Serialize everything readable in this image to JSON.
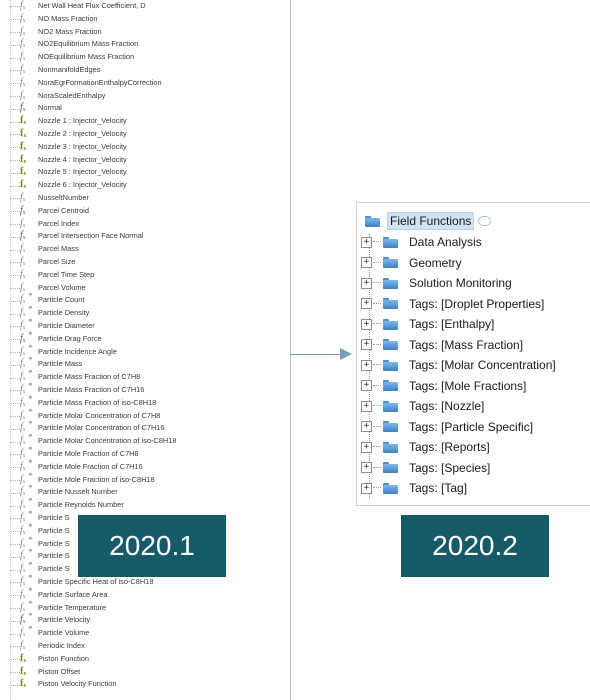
{
  "left_panel": {
    "version": "2020.1",
    "items": [
      {
        "label": "Net Wall Heat Flux Coefficient, D",
        "icon": "f-icon"
      },
      {
        "label": "NO Mass Fraction",
        "icon": "f-icon"
      },
      {
        "label": "NO2 Mass Fraction",
        "icon": "f-icon"
      },
      {
        "label": "NO2Equilibrium Mass Fraction",
        "icon": "f-icon"
      },
      {
        "label": "NOEquilibrium Mass Fraction",
        "icon": "f-icon"
      },
      {
        "label": "NonmanifoldEdges",
        "icon": "f-icon"
      },
      {
        "label": "NoraEgrFormationEnthalpyCorrection",
        "icon": "f-icon"
      },
      {
        "label": "NoraScaledEnthalpy",
        "icon": "f-icon"
      },
      {
        "label": "Normal",
        "icon": "vector-f-icon"
      },
      {
        "label": "Nozzle 1 : Injector_Velocity",
        "icon": "green-f-icon"
      },
      {
        "label": "Nozzle 2 : Injector_Velocity",
        "icon": "green-f-icon"
      },
      {
        "label": "Nozzle 3 : Injector_Velocity",
        "icon": "green-f-icon"
      },
      {
        "label": "Nozzle 4 : Injector_Velocity",
        "icon": "green-f-icon"
      },
      {
        "label": "Nozzle 5 : Injector_Velocity",
        "icon": "green-f-icon"
      },
      {
        "label": "Nozzle 6 : Injector_Velocity",
        "icon": "green-f-icon"
      },
      {
        "label": "NusseltNumber",
        "icon": "f-icon"
      },
      {
        "label": "Parcel Centroid",
        "icon": "vector-f-icon"
      },
      {
        "label": "Parcel Index",
        "icon": "f-icon"
      },
      {
        "label": "Parcel Intersection Face Normal",
        "icon": "vector-f-icon"
      },
      {
        "label": "Parcel Mass",
        "icon": "f-icon"
      },
      {
        "label": "Parcel Size",
        "icon": "f-icon"
      },
      {
        "label": "Parcel Time Step",
        "icon": "f-icon"
      },
      {
        "label": "Parcel Volume",
        "icon": "f-icon"
      },
      {
        "label": "Particle Count",
        "icon": "star-f-icon"
      },
      {
        "label": "Particle Density",
        "icon": "star-f-icon"
      },
      {
        "label": "Particle Diameter",
        "icon": "star-f-icon"
      },
      {
        "label": "Particle Drag Force",
        "icon": "star-vector-f-icon"
      },
      {
        "label": "Particle Incidence Angle",
        "icon": "star-f-icon"
      },
      {
        "label": "Particle Mass",
        "icon": "star-f-icon"
      },
      {
        "label": "Particle Mass Fraction of C7H8",
        "icon": "star-f-icon"
      },
      {
        "label": "Particle Mass Fraction of C7H16",
        "icon": "star-f-icon"
      },
      {
        "label": "Particle Mass Fraction of iso-C8H18",
        "icon": "star-f-icon"
      },
      {
        "label": "Particle Molar Concentration of C7H8",
        "icon": "star-f-icon"
      },
      {
        "label": "Particle Molar Concentration of C7H16",
        "icon": "star-f-icon"
      },
      {
        "label": "Particle Molar Concentration of iso-C8H18",
        "icon": "star-f-icon"
      },
      {
        "label": "Particle Mole Fraction of C7H8",
        "icon": "star-f-icon"
      },
      {
        "label": "Particle Mole Fraction of C7H16",
        "icon": "star-f-icon"
      },
      {
        "label": "Particle Mole Fraction of iso-C8H18",
        "icon": "star-f-icon"
      },
      {
        "label": "Particle Nusselt Number",
        "icon": "star-f-icon"
      },
      {
        "label": "Particle Reynolds Number",
        "icon": "star-f-icon"
      },
      {
        "label": "Particle S",
        "icon": "star-f-icon"
      },
      {
        "label": "Particle S",
        "icon": "star-f-icon"
      },
      {
        "label": "Particle S",
        "icon": "star-f-icon"
      },
      {
        "label": "Particle S",
        "icon": "star-f-icon"
      },
      {
        "label": "Particle S",
        "icon": "star-f-icon"
      },
      {
        "label": "Particle Specific Heat of iso-C8H18",
        "icon": "star-f-icon"
      },
      {
        "label": "Particle Surface Area",
        "icon": "star-f-icon"
      },
      {
        "label": "Particle Temperature",
        "icon": "star-f-icon"
      },
      {
        "label": "Particle Velocity",
        "icon": "star-vector-f-icon"
      },
      {
        "label": "Particle Volume",
        "icon": "star-f-icon"
      },
      {
        "label": "Periodic Index",
        "icon": "f-icon"
      },
      {
        "label": "Piston Function",
        "icon": "green-f-icon"
      },
      {
        "label": "Piston Offset",
        "icon": "green-f-icon"
      },
      {
        "label": "Piston Velocity Function",
        "icon": "green-f-icon"
      }
    ]
  },
  "right_panel": {
    "version": "2020.2",
    "root_label": "Field Functions",
    "items": [
      "Data Analysis",
      "Geometry",
      "Solution Monitoring",
      "Tags: [Droplet Properties]",
      "Tags: [Enthalpy]",
      "Tags: [Mass Fraction]",
      "Tags: [Molar Concentration]",
      "Tags: [Mole Fractions]",
      "Tags: [Nozzle]",
      "Tags: [Particle Specific]",
      "Tags: [Reports]",
      "Tags: [Species]",
      "Tags: [Tag]"
    ],
    "expander_symbol": "+"
  },
  "colors": {
    "version_box": "#165a6a",
    "arrow": "#7b9db5",
    "selection": "#cfe3f5"
  }
}
